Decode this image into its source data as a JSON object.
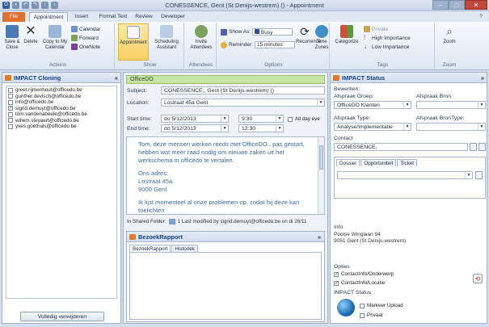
{
  "window": {
    "title": "CONESSENCE, Gent (St Denijs-westrem) () - Appointment"
  },
  "tabs": [
    "File",
    "Appointment",
    "Insert",
    "Format Text",
    "Review",
    "Developer"
  ],
  "ribbon": {
    "actions": {
      "save_close": "Save & Close",
      "delete": "Delete",
      "copy_to_calendar": "Copy to My Calendar",
      "calendar": "Calendar",
      "forward": "Forward",
      "onenote": "OneNote",
      "label": "Actions"
    },
    "show": {
      "appointment": "Appointment",
      "scheduling": "Scheduling Assistant",
      "label": "Show"
    },
    "attendees": {
      "invite": "Invite Attendees",
      "label": "Attendees"
    },
    "options": {
      "show_as_label": "Show As:",
      "show_as_value": "Busy",
      "reminder_label": "Reminder:",
      "reminder_value": "15 minutes",
      "recurrence": "Recurrence",
      "time_zones": "Time Zones",
      "label": "Options"
    },
    "tags": {
      "categorize": "Categorize",
      "private": "Private",
      "high_importance": "High Importance",
      "low_importance": "Low Importance",
      "label": "Tags"
    },
    "zoom": {
      "zoom": "Zoom",
      "label": "Zoom"
    }
  },
  "cloning": {
    "title": "IMPACT Cloning",
    "collapse": "«",
    "emails": [
      {
        "email": "greet.rijmenhout@officedo.be",
        "checked": false
      },
      {
        "email": "gunther.devisch@officedo.be",
        "checked": false
      },
      {
        "email": "info@officedo.be",
        "checked": false
      },
      {
        "email": "sigrid.demuyt@officedo.be",
        "checked": true
      },
      {
        "email": "tom.vandenabeele@officedo.be",
        "checked": false
      },
      {
        "email": "willem.steyaert@officedo.be",
        "checked": false
      },
      {
        "email": "yves.goethals@officedo.be",
        "checked": false
      }
    ],
    "delete_all": "Volledig verwijderen"
  },
  "appointment": {
    "banner": "OfficeDO",
    "subject_label": "Subject:",
    "subject_value": "CONESSENCE,, Gent (St Denijs-westrem) ()",
    "location_label": "Location:",
    "location_value": "Lostraat 45a Gent",
    "start_label": "Start time:",
    "start_date": "do 5/12/2013",
    "start_time": "9:30",
    "end_label": "End time:",
    "end_date": "do 5/12/2013",
    "end_time": "12:30",
    "all_day": "All day eve",
    "body": [
      "Tom, deze mensen werken reeds met OfficeDO , pas gestart,",
      "hebben wat meer raad nodig om nieuwe zaken uit het",
      "werkschema in officedo te vertalen.",
      "",
      "Ons adres:",
      "Lostraat 45a",
      "9000 Gent",
      "",
      "Ik lijst momenteel al onze problemen op, zodat hij deze kan",
      "toelichten"
    ],
    "shared_folder": "In Shared Folder:",
    "modified": "1  Last modified by sigrid.demuyt@officedo.be on di 26/11"
  },
  "bezoek": {
    "title": "BezoekRapport",
    "collapse": "»",
    "tabs": [
      "BezoekRapport",
      "Historiek"
    ]
  },
  "status": {
    "title": "IMPACT Status",
    "collapse": "»",
    "bewerken": "Bewerken:",
    "afspraak_groep_label": "Afspraak Groep:",
    "afspraak_groep_value": "OfficeDO Klanten",
    "afspraak_bron_label": "Afspraak Bron:",
    "afspraak_bron_value": "",
    "afspraak_type_label": "Afspraak Type:",
    "afspraak_type_value": "Analyse/Implementatie",
    "afspraak_brontype_label": "Afspraak BronType:",
    "afspraak_brontype_value": "",
    "contact_label": "Contact",
    "contact_value": "CONESSENCE,",
    "subtabs": [
      "Dossier",
      "Opportuniteit",
      "Ticket"
    ],
    "info_label": "Info",
    "info_lines": [
      "Poolse Winglaan 94",
      "9051  Gent (St Denijs-westrem)"
    ],
    "opties_label": "Opties",
    "opties": [
      {
        "label": "ContactInfo/Onderwerp",
        "checked": true
      },
      {
        "label": "ContactInfo/Locatie",
        "checked": true
      }
    ],
    "impact_status_label": "IMPACT Status",
    "flags": [
      {
        "label": "Markeer Upload",
        "checked": false
      },
      {
        "label": "Privaat",
        "checked": false
      }
    ]
  },
  "colors": {
    "accent": "#e0702b",
    "header_blue": "#15428b",
    "banner_green": "#c9e3a6",
    "body_text": "#3a6ea8"
  }
}
